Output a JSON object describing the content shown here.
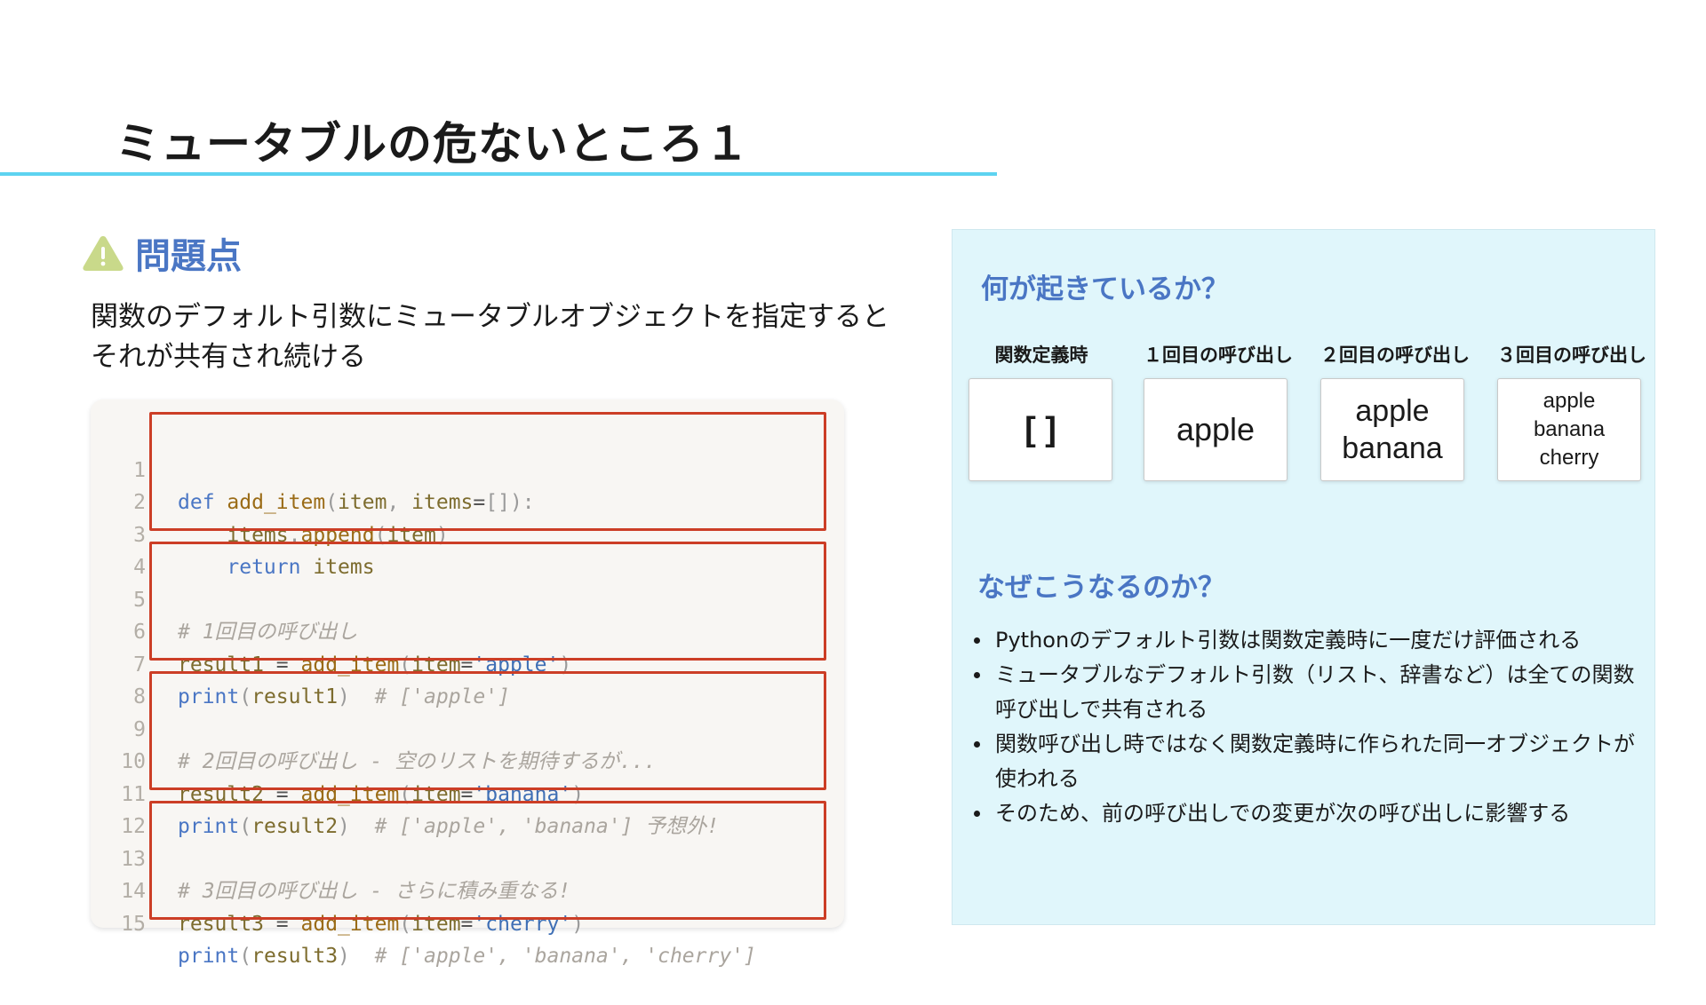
{
  "title": "ミュータブルの危ないところ１",
  "problem": {
    "icon": "warning-icon",
    "heading": "問題点",
    "description_lines": [
      "関数のデフォルト引数にミュータブルオブジェクトを指定すると",
      "それが共有され続ける"
    ]
  },
  "code": {
    "lines": [
      {
        "n": "1",
        "text": "def add_item(item, items=[]):"
      },
      {
        "n": "2",
        "text": "    items.append(item)"
      },
      {
        "n": "3",
        "text": "    return items"
      },
      {
        "n": "4",
        "text": ""
      },
      {
        "n": "5",
        "text": "# 1回目の呼び出し"
      },
      {
        "n": "6",
        "text": "result1 = add_item(item='apple')"
      },
      {
        "n": "7",
        "text": "print(result1)  # ['apple']"
      },
      {
        "n": "8",
        "text": ""
      },
      {
        "n": "9",
        "text": "# 2回目の呼び出し - 空のリストを期待するが..."
      },
      {
        "n": "10",
        "text": "result2 = add_item(item='banana')"
      },
      {
        "n": "11",
        "text": "print(result2)  # ['apple', 'banana'] 予想外!"
      },
      {
        "n": "12",
        "text": ""
      },
      {
        "n": "13",
        "text": "# 3回目の呼び出し - さらに積み重なる!"
      },
      {
        "n": "14",
        "text": "result3 = add_item(item='cherry')"
      },
      {
        "n": "15",
        "text": "print(result3)  # ['apple', 'banana', 'cherry']"
      }
    ],
    "highlight_color": "#cc3e26"
  },
  "what_happens": {
    "heading": "何が起きているか？",
    "states": [
      {
        "label": "関数定義時",
        "values": [
          "[ ]"
        ]
      },
      {
        "label": "１回目の呼び出し",
        "values": [
          "apple"
        ]
      },
      {
        "label": "２回目の呼び出し",
        "values": [
          "apple",
          "banana"
        ]
      },
      {
        "label": "３回目の呼び出し",
        "values": [
          "apple",
          "banana",
          "cherry"
        ]
      }
    ]
  },
  "why": {
    "heading": "なぜこうなるのか？",
    "items": [
      [
        "Pythonのデフォルト引数は関数定義時に一度だけ評価される"
      ],
      [
        "ミュータブルなデフォルト引数（リスト、辞書など）は全ての関数",
        "呼び出しで共有される"
      ],
      [
        "関数呼び出し時ではなく関数定義時に作られた同一オブジェクトが",
        "使われる"
      ],
      [
        "そのため、前の呼び出しでの変更が次の呼び出しに影響する"
      ]
    ]
  },
  "colors": {
    "accent_rule": "#5dd3f0",
    "heading_blue": "#4a76c4",
    "warning_icon": "#c9d98a",
    "panel_bg": "#e0f6fb",
    "code_bg": "#f8f6f3"
  }
}
